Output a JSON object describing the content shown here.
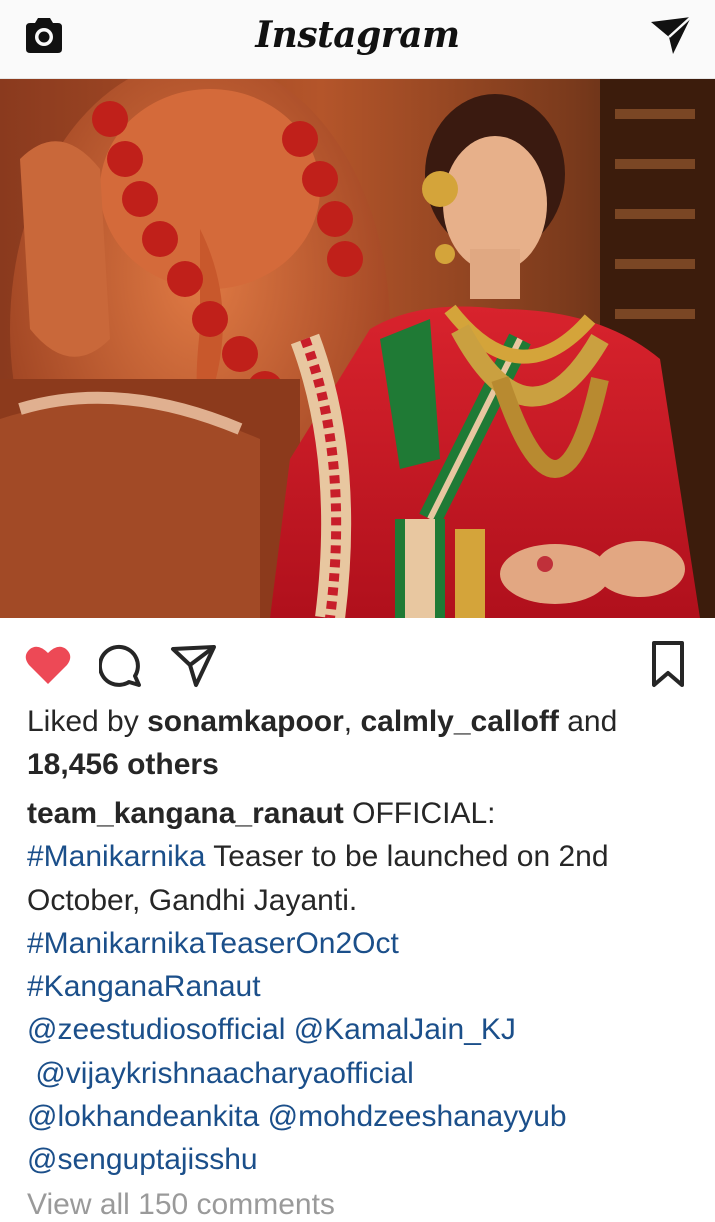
{
  "header": {
    "logo": "Instagram",
    "icons": [
      "camera-icon",
      "direct-message-icon"
    ]
  },
  "post": {
    "image_icon": "post-photo",
    "actions": {
      "icons": [
        "heart-icon",
        "comment-icon",
        "share-icon",
        "bookmark-icon"
      ],
      "heart_color": "#ed4956"
    },
    "likes": {
      "prefix": "Liked by ",
      "user1": "sonamkapoor",
      "sep": ", ",
      "user2": "calmly_calloff",
      "and": " and",
      "others": "18,456 others"
    },
    "caption": {
      "username": "team_kangana_ranaut",
      "text1": " OFFICIAL:",
      "hashtag1": "#Manikarnika",
      "text2": " Teaser to be launched on 2nd",
      "text3": "October, Gandhi Jayanti.",
      "hashtag2": "#ManikarnikaTeaserOn2Oct",
      "hashtag3": "#KanganaRanaut",
      "mention1": "@zeestudiosofficial",
      "mention2": "@KamalJain_KJ",
      "mention3": "@vijaykrishnaacharyaofficial",
      "mention4": "@lokhandeankita",
      "mention5": "@mohdzeeshanayyub",
      "mention6": "@senguptajisshu"
    },
    "view_comments": "View all 150 comments"
  },
  "colors": {
    "link": "#1b4f8a",
    "text": "#262626",
    "heart": "#ed4956"
  }
}
